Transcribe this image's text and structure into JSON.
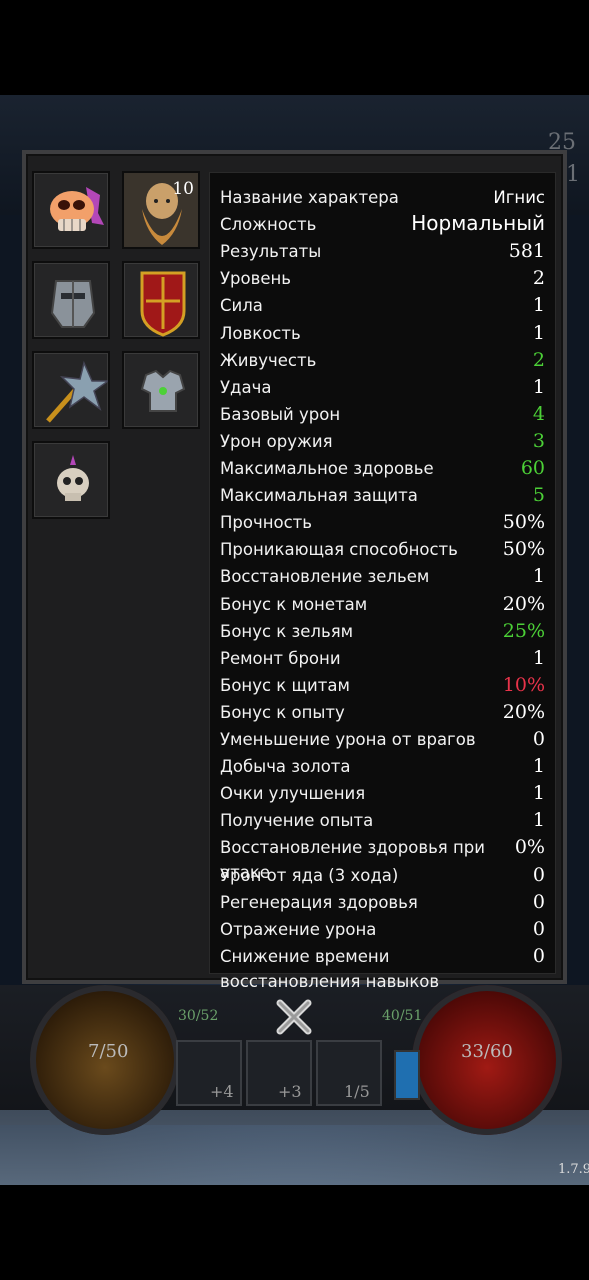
{
  "background": {
    "top_right_numbers": [
      "25",
      "1"
    ],
    "left_orb_text": "7/50",
    "right_orb_text": "33/60",
    "bar_left_text": "30/52",
    "bar_right_text": "40/51",
    "slot_labels": [
      "+4",
      "+3",
      "1/5"
    ],
    "version": "1.7.9"
  },
  "equipment": {
    "character_level": "10",
    "slots": [
      {
        "name": "mask-icon"
      },
      {
        "name": "dwarf-portrait-icon"
      },
      {
        "name": "helmet-icon"
      },
      {
        "name": "shield-icon"
      },
      {
        "name": "mace-icon"
      },
      {
        "name": "armor-icon"
      },
      {
        "name": "skull-amulet-icon"
      }
    ]
  },
  "stats": [
    {
      "label": "Название характера",
      "value": "Игнис",
      "color": "#ffffff",
      "font": "sans"
    },
    {
      "label": "Сложность",
      "value": "Нормальный",
      "color": "#ffffff",
      "font": "sans-big"
    },
    {
      "label": "Результаты",
      "value": "581",
      "color": "#ffffff"
    },
    {
      "label": "Уровень",
      "value": "2",
      "color": "#ffffff"
    },
    {
      "label": "Сила",
      "value": "1",
      "color": "#ffffff"
    },
    {
      "label": "Ловкость",
      "value": "1",
      "color": "#ffffff"
    },
    {
      "label": "Живучесть",
      "value": "2",
      "color": "#4cd137"
    },
    {
      "label": "Удача",
      "value": "1",
      "color": "#ffffff"
    },
    {
      "label": "Базовый урон",
      "value": "4",
      "color": "#4cd137"
    },
    {
      "label": "Урон оружия",
      "value": "3",
      "color": "#4cd137"
    },
    {
      "label": "Максимальное здоровье",
      "value": "60",
      "color": "#4cd137"
    },
    {
      "label": "Максимальная защита",
      "value": "5",
      "color": "#4cd137"
    },
    {
      "label": "Прочность",
      "value": "50%",
      "color": "#ffffff"
    },
    {
      "label": "Проникающая способность",
      "value": "50%",
      "color": "#ffffff"
    },
    {
      "label": "Восстановление зельем",
      "value": "1",
      "color": "#ffffff"
    },
    {
      "label": "Бонус к монетам",
      "value": "20%",
      "color": "#ffffff"
    },
    {
      "label": "Бонус к зельям",
      "value": "25%",
      "color": "#4cd137"
    },
    {
      "label": "Ремонт брони",
      "value": "1",
      "color": "#ffffff"
    },
    {
      "label": "Бонус к щитам",
      "value": "10%",
      "color": "#e8334a"
    },
    {
      "label": "Бонус к опыту",
      "value": "20%",
      "color": "#ffffff"
    },
    {
      "label": "Уменьшение урона от врагов",
      "value": "0",
      "color": "#ffffff"
    },
    {
      "label": "Добыча золота",
      "value": "1",
      "color": "#ffffff"
    },
    {
      "label": "Очки улучшения",
      "value": "1",
      "color": "#ffffff"
    },
    {
      "label": "Получение опыта",
      "value": "1",
      "color": "#ffffff"
    },
    {
      "label": "Восстановление здоровья при",
      "label2": "атаке",
      "value": "0%",
      "color": "#ffffff"
    },
    {
      "label": "Урон от яда (3 хода)",
      "value": "0",
      "color": "#ffffff"
    },
    {
      "label": "Регенерация здоровья",
      "value": "0",
      "color": "#ffffff"
    },
    {
      "label": "Отражение урона",
      "value": "0",
      "color": "#ffffff"
    },
    {
      "label": "Снижение времени",
      "label2": "восстановления навыков",
      "value": "0",
      "color": "#ffffff"
    }
  ]
}
